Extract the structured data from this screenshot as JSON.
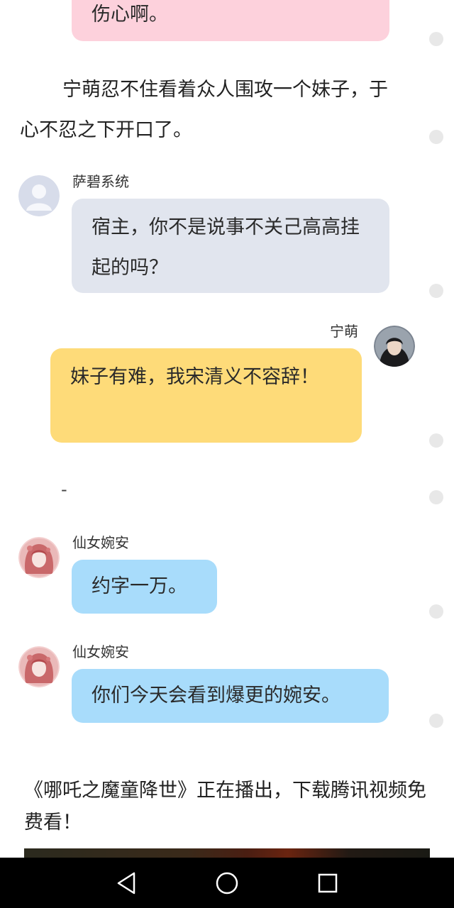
{
  "messages": {
    "partial_top": {
      "text": "伤心啊。"
    },
    "narration": {
      "text": "宁萌忍不住看着众人围攻一个妹子，于心不忍之下开口了。"
    },
    "system": {
      "sender": "萨碧系统",
      "text": "宿主，你不是说事不关己高高挂起的吗？"
    },
    "user": {
      "sender": "宁萌",
      "text": "妹子有难，我宋清义不容辞！"
    },
    "separator": "-",
    "author_1": {
      "sender": "仙女婉安",
      "text": "约字一万。"
    },
    "author_2": {
      "sender": "仙女婉安",
      "text": "你们今天会看到爆更的婉安。"
    }
  },
  "promo": {
    "text": "《哪吒之魔童降世》正在播出，下载腾讯视频免费看！"
  },
  "colors": {
    "pink_bubble": "#fdd1dc",
    "grey_bubble": "#e1e5ee",
    "yellow_bubble": "#fedb79",
    "blue_bubble": "#a8dcfb",
    "nav_bar": "#000000"
  },
  "icons": {
    "system_avatar": "default-user-avatar-icon",
    "nav_back": "triangle-back-icon",
    "nav_home": "circle-home-icon",
    "nav_recent": "square-recent-icon"
  }
}
